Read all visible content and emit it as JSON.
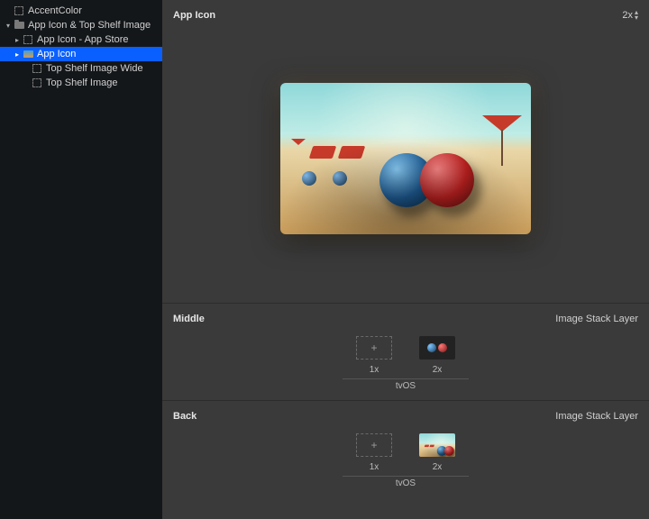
{
  "sidebar": {
    "items": [
      {
        "label": "AccentColor",
        "icon": "box",
        "indent": 1,
        "disclosure": ""
      },
      {
        "label": "App Icon & Top Shelf Image",
        "icon": "folder",
        "indent": 1,
        "disclosure": "open"
      },
      {
        "label": "App Icon - App Store",
        "icon": "box",
        "indent": 2,
        "disclosure": "closed"
      },
      {
        "label": "App Icon",
        "icon": "app",
        "indent": 2,
        "disclosure": "closed",
        "selected": true
      },
      {
        "label": "Top Shelf Image Wide",
        "icon": "box",
        "indent": 3,
        "disclosure": ""
      },
      {
        "label": "Top Shelf Image",
        "icon": "box",
        "indent": 3,
        "disclosure": ""
      }
    ]
  },
  "main": {
    "sections": [
      {
        "title": "App Icon",
        "right_control": {
          "label": "2x"
        }
      },
      {
        "title": "Middle",
        "right_text": "Image Stack Layer",
        "slots": [
          {
            "kind": "empty",
            "label": "1x"
          },
          {
            "kind": "balls",
            "label": "2x"
          }
        ],
        "platform": "tvOS"
      },
      {
        "title": "Back",
        "right_text": "Image Stack Layer",
        "slots": [
          {
            "kind": "empty",
            "label": "1x"
          },
          {
            "kind": "beach",
            "label": "2x"
          }
        ],
        "platform": "tvOS"
      }
    ]
  }
}
